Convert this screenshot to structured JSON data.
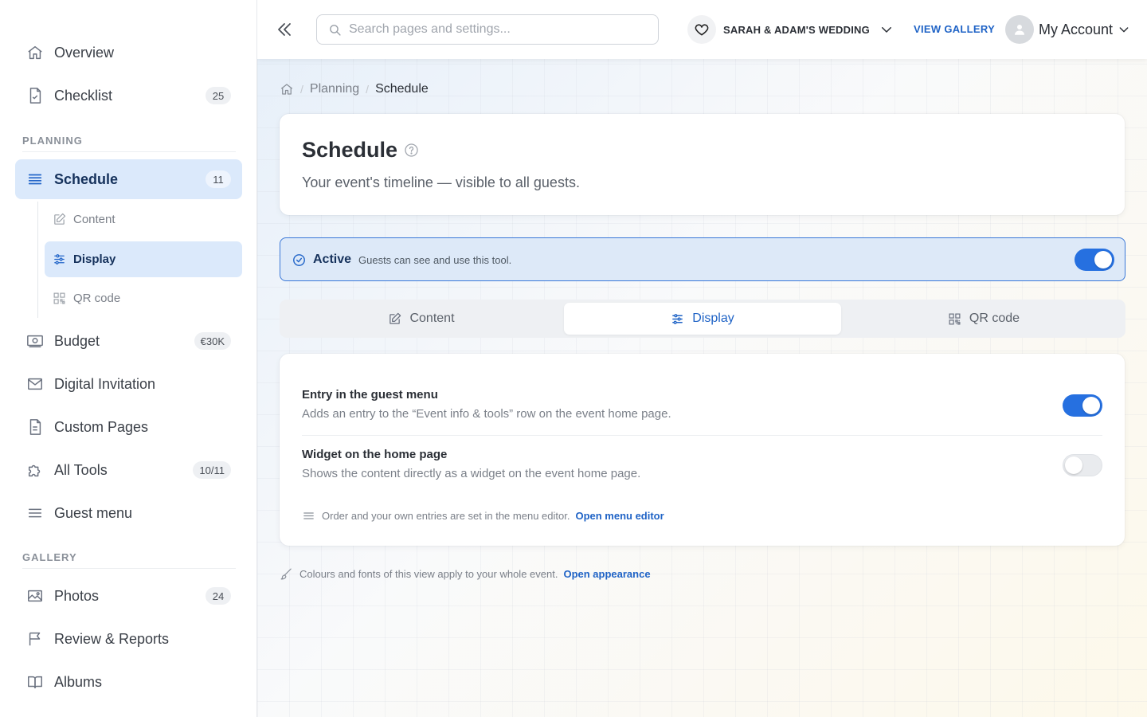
{
  "sidebar": {
    "overview": {
      "label": "Overview",
      "icon": "home-icon"
    },
    "checklist": {
      "label": "Checklist",
      "badge": "25",
      "icon": "checklist-icon"
    },
    "planning_heading": "PLANNING",
    "schedule": {
      "label": "Schedule",
      "badge": "11",
      "icon": "list-icon"
    },
    "schedule_sub": {
      "content": "Content",
      "display": "Display",
      "qr": "QR code"
    },
    "budget": {
      "label": "Budget",
      "badge": "€30K",
      "icon": "money-icon"
    },
    "invitation": {
      "label": "Digital Invitation",
      "icon": "mail-icon"
    },
    "custom_pages": {
      "label": "Custom Pages",
      "icon": "document-icon"
    },
    "all_tools": {
      "label": "All Tools",
      "badge": "10/11",
      "icon": "puzzle-icon"
    },
    "guest_menu": {
      "label": "Guest menu",
      "icon": "menu-icon"
    },
    "gallery_heading": "GALLERY",
    "photos": {
      "label": "Photos",
      "badge": "24",
      "icon": "image-icon"
    },
    "review": {
      "label": "Review & Reports",
      "icon": "flag-icon"
    },
    "albums": {
      "label": "Albums",
      "icon": "book-icon"
    }
  },
  "topbar": {
    "search_placeholder": "Search pages and settings...",
    "event_name": "SARAH & ADAM'S WEDDING",
    "view_gallery": "VIEW GALLERY",
    "account": "My Account"
  },
  "breadcrumb": {
    "sep": "/",
    "planning": "Planning",
    "current": "Schedule"
  },
  "header": {
    "title": "Schedule",
    "subtitle": "Your event's timeline — visible to all guests."
  },
  "status": {
    "label": "Active",
    "description": "Guests can see and use this tool.",
    "enabled": true
  },
  "tabs": {
    "content": "Content",
    "display": "Display",
    "qr": "QR code",
    "selected": "Display"
  },
  "settings": {
    "guest_menu": {
      "title": "Entry in the guest menu",
      "description": "Adds an entry to the “Event info & tools” row on the event home page.",
      "enabled": true
    },
    "widget": {
      "title": "Widget on the home page",
      "description": "Shows the content directly as a widget on the event home page.",
      "enabled": false
    },
    "menu_note": "Order and your own entries are set in the menu editor.",
    "menu_link": "Open menu editor"
  },
  "appearance": {
    "note": "Colours and fonts of this view apply to your whole event.",
    "link": "Open appearance"
  },
  "colors": {
    "accent": "#2670e0",
    "active_bg": "#dbe9fb",
    "link": "#1f63c6"
  }
}
